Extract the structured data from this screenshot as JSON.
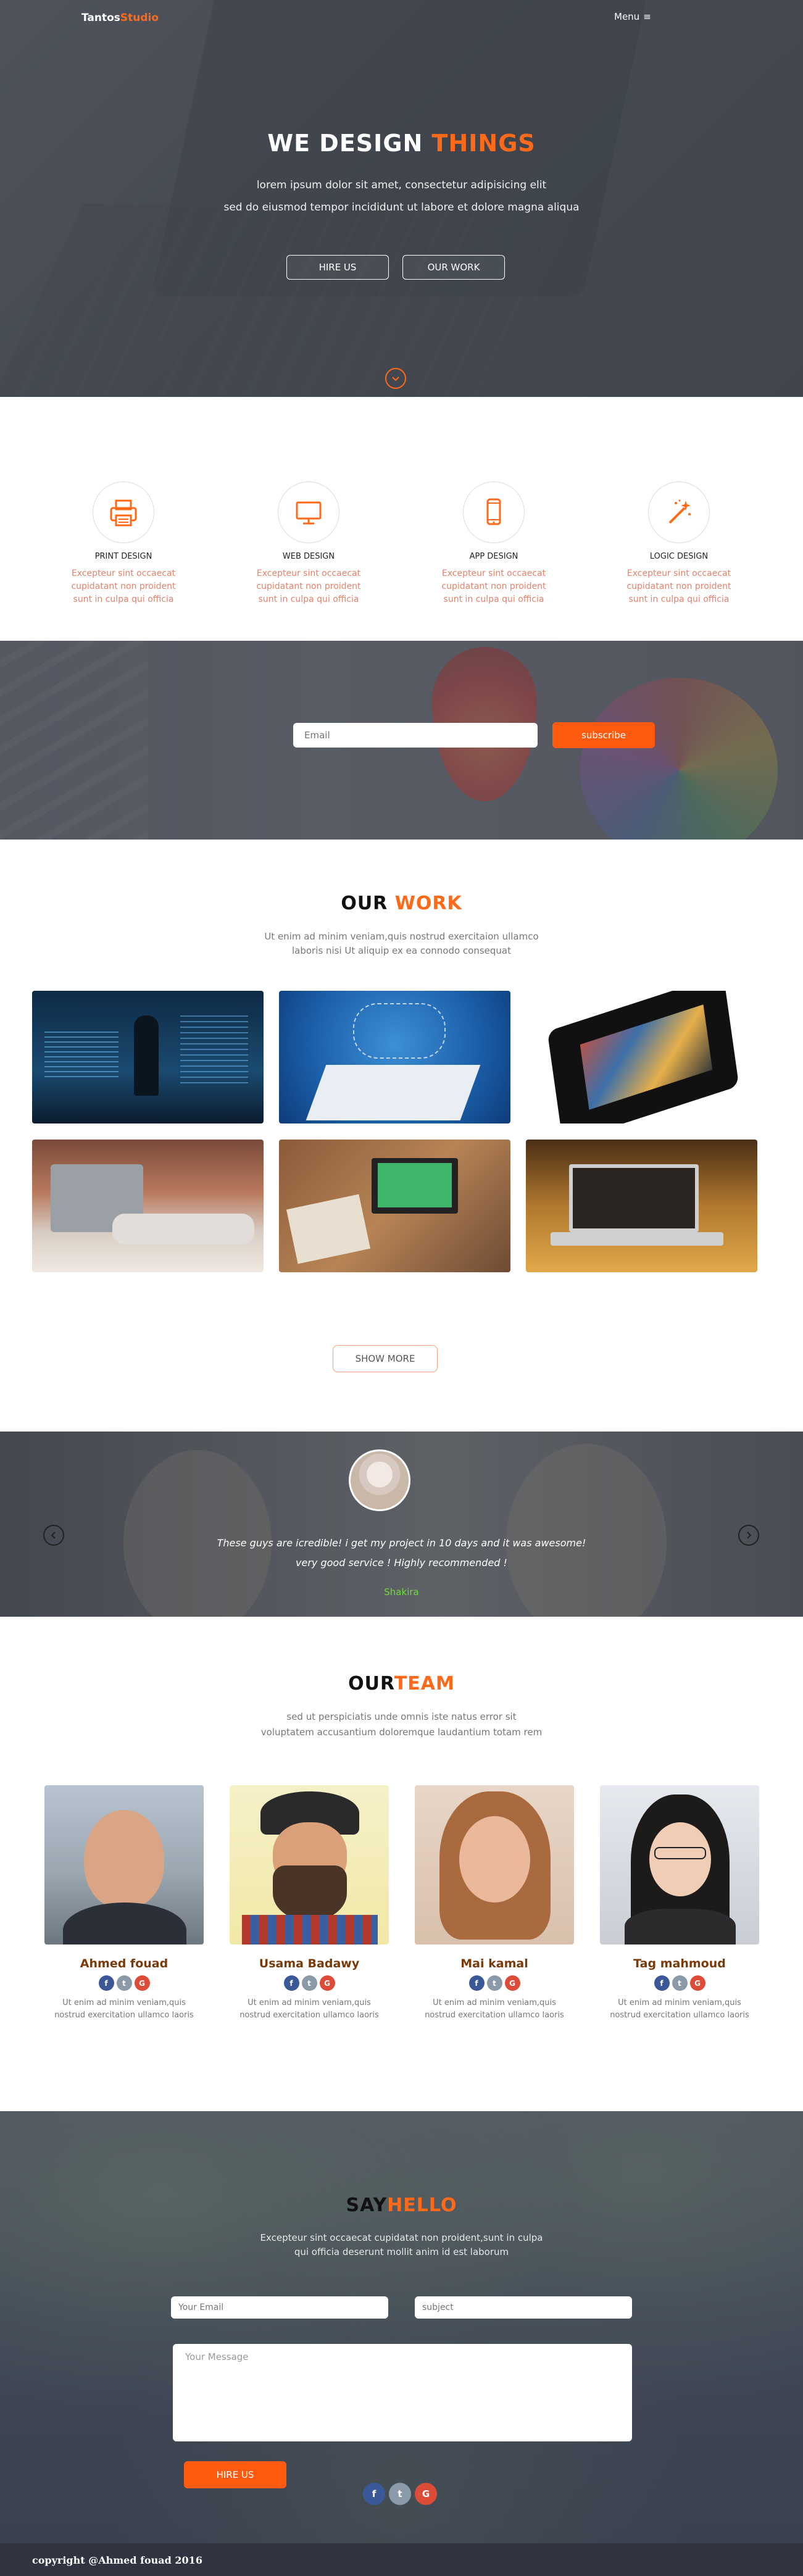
{
  "brand": {
    "name_part1": "Tantos",
    "name_part2": "Studio"
  },
  "nav": {
    "menu_label": "Menu",
    "menu_icon": "≡"
  },
  "hero": {
    "title_part1": "WE DESIGN",
    "title_part2": "THINGS",
    "line1": "lorem ipsum dolor sit amet, consectetur adipisicing elit",
    "line2": "sed do eiusmod tempor incididunt ut labore et dolore magna aliqua",
    "btn_hire": "HIRE US",
    "btn_work": "OUR WORK",
    "scroll_icon": "chevron-down-icon"
  },
  "services": [
    {
      "title": "PRINT DESIGN",
      "icon": "printer-icon",
      "desc1": "Excepteur sint occaecat",
      "desc2": "cupidatant non proident",
      "desc3": "sunt in culpa qui officia"
    },
    {
      "title": "WEB DESIGN",
      "icon": "monitor-icon",
      "desc1": "Excepteur sint occaecat",
      "desc2": "cupidatant non proident",
      "desc3": "sunt in culpa qui officia"
    },
    {
      "title": "APP DESIGN",
      "icon": "smartphone-icon",
      "desc1": "Excepteur sint occaecat",
      "desc2": "cupidatant non proident",
      "desc3": "sunt in culpa qui officia"
    },
    {
      "title": "LOGIC DESIGN",
      "icon": "magic-wand-icon",
      "desc1": "Excepteur sint occaecat",
      "desc2": "cupidatant non proident",
      "desc3": "sunt in culpa qui officia"
    }
  ],
  "subscribe": {
    "placeholder": "Email",
    "button": "subscribe"
  },
  "work": {
    "title_part1": "OUR",
    "title_part2": "WORK",
    "desc1": "Ut enim ad minim veniam,quis nostrud exercitaion ullamco",
    "desc2": "laboris nisi Ut aliquip ex ea connodo consequat",
    "show_more": "SHOW MORE"
  },
  "testimonial": {
    "quote1": "These guys are icredible! i get my project in 10 days and it was awesome!",
    "quote2": "very good service ! Highly recommended !",
    "name": "Shakira"
  },
  "team": {
    "title_part1": "OUR",
    "title_part2": "TEAM",
    "desc1": "sed ut perspiciatis unde omnis iste natus error sit",
    "desc2": "voluptatem accusantium doloremque laudantium totam rem",
    "members": [
      {
        "name": "Ahmed fouad",
        "desc1": "Ut enim ad minim veniam,quis",
        "desc2": "nostrud exercitation ullamco laoris"
      },
      {
        "name": "Usama Badawy",
        "desc1": "Ut enim ad minim veniam,quis",
        "desc2": "nostrud exercitation ullamco laoris"
      },
      {
        "name": "Mai kamal",
        "desc1": "Ut enim ad minim veniam,quis",
        "desc2": "nostrud exercitation ullamco laoris"
      },
      {
        "name": "Tag mahmoud",
        "desc1": "Ut enim ad minim veniam,quis",
        "desc2": "nostrud exercitation ullamco laoris"
      }
    ]
  },
  "social": {
    "facebook": "f",
    "twitter": "t",
    "google": "G"
  },
  "contact": {
    "title_part1": "SAY",
    "title_part2": "HELLO",
    "desc1": "Excepteur sint occaecat cupidatat non proident,sunt in culpa",
    "desc2": "qui officia deserunt mollit anim id est laborum",
    "email_placeholder": "Your Email",
    "subject_placeholder": "subject",
    "message_placeholder": "Your Message",
    "button": "HIRE US"
  },
  "footer": {
    "copyright": "copyright @Ahmed fouad 2016"
  },
  "colors": {
    "accent": "#ff6a1a",
    "testimonial_name": "#6fdc3c",
    "member_name": "#7a3a0a"
  }
}
